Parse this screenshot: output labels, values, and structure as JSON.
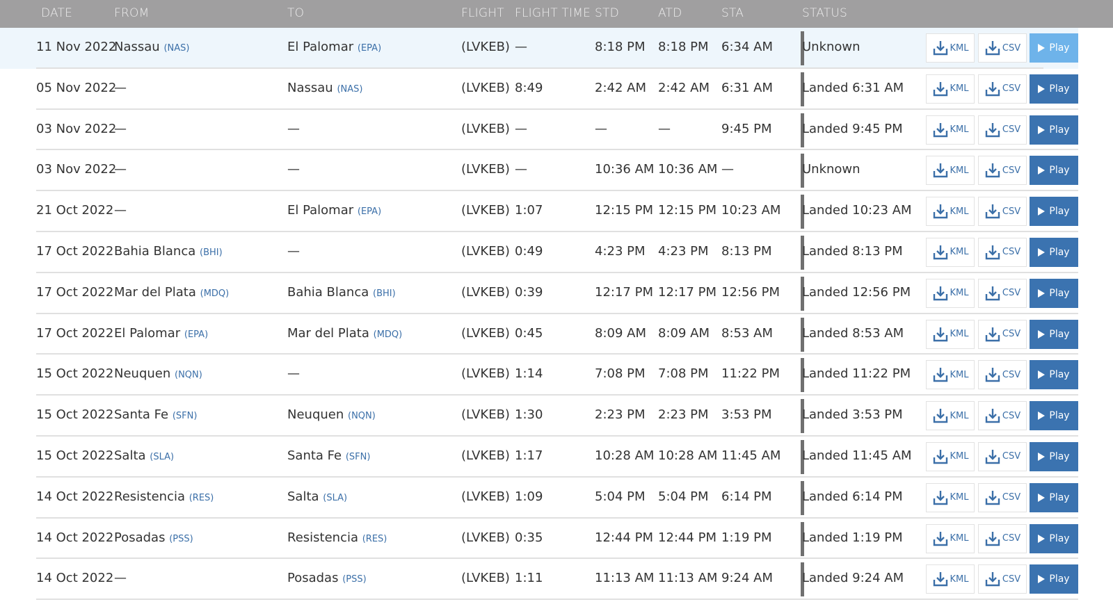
{
  "header": {
    "date": "DATE",
    "from": "FROM",
    "to": "TO",
    "flight": "FLIGHT",
    "flight_time": "FLIGHT TIME",
    "std": "STD",
    "atd": "ATD",
    "sta": "STA",
    "status": "STATUS"
  },
  "buttons": {
    "kml": "KML",
    "csv": "CSV",
    "play": "Play"
  },
  "colors": {
    "header_bg": "#a09fa0",
    "play": "#3b73b0",
    "play_light": "#6eb3ea",
    "code": "#3b6fa8",
    "highlight": "#eef6fc"
  },
  "rows": [
    {
      "date": "11 Nov 2022",
      "from": "Nassau",
      "from_code": "(NAS)",
      "to": "El Palomar",
      "to_code": "(EPA)",
      "flight": "(LVKEB)",
      "flight_time": "—",
      "std": "8:18 PM",
      "atd": "8:18 PM",
      "sta": "6:34 AM",
      "status": "Unknown",
      "highlighted": true
    },
    {
      "date": "05 Nov 2022",
      "from": "—",
      "from_code": "",
      "to": "Nassau",
      "to_code": "(NAS)",
      "flight": "(LVKEB)",
      "flight_time": "8:49",
      "std": "2:42 AM",
      "atd": "2:42 AM",
      "sta": "6:31 AM",
      "status": "Landed 6:31 AM"
    },
    {
      "date": "03 Nov 2022",
      "from": "—",
      "from_code": "",
      "to": "—",
      "to_code": "",
      "flight": "(LVKEB)",
      "flight_time": "—",
      "std": "—",
      "atd": "—",
      "sta": "9:45 PM",
      "status": "Landed 9:45 PM"
    },
    {
      "date": "03 Nov 2022",
      "from": "—",
      "from_code": "",
      "to": "—",
      "to_code": "",
      "flight": "(LVKEB)",
      "flight_time": "—",
      "std": "10:36 AM",
      "atd": "10:36 AM",
      "sta": "—",
      "status": "Unknown"
    },
    {
      "date": "21 Oct 2022",
      "from": "—",
      "from_code": "",
      "to": "El Palomar",
      "to_code": "(EPA)",
      "flight": "(LVKEB)",
      "flight_time": "1:07",
      "std": "12:15 PM",
      "atd": "12:15 PM",
      "sta": "10:23 AM",
      "status": "Landed 10:23 AM"
    },
    {
      "date": "17 Oct 2022",
      "from": "Bahia Blanca",
      "from_code": "(BHI)",
      "to": "—",
      "to_code": "",
      "flight": "(LVKEB)",
      "flight_time": "0:49",
      "std": "4:23 PM",
      "atd": "4:23 PM",
      "sta": "8:13 PM",
      "status": "Landed 8:13 PM"
    },
    {
      "date": "17 Oct 2022",
      "from": "Mar del Plata",
      "from_code": "(MDQ)",
      "to": "Bahia Blanca",
      "to_code": "(BHI)",
      "flight": "(LVKEB)",
      "flight_time": "0:39",
      "std": "12:17 PM",
      "atd": "12:17 PM",
      "sta": "12:56 PM",
      "status": "Landed 12:56 PM"
    },
    {
      "date": "17 Oct 2022",
      "from": "El Palomar",
      "from_code": "(EPA)",
      "to": "Mar del Plata",
      "to_code": "(MDQ)",
      "flight": "(LVKEB)",
      "flight_time": "0:45",
      "std": "8:09 AM",
      "atd": "8:09 AM",
      "sta": "8:53 AM",
      "status": "Landed 8:53 AM"
    },
    {
      "date": "15 Oct 2022",
      "from": "Neuquen",
      "from_code": "(NQN)",
      "to": "—",
      "to_code": "",
      "flight": "(LVKEB)",
      "flight_time": "1:14",
      "std": "7:08 PM",
      "atd": "7:08 PM",
      "sta": "11:22 PM",
      "status": "Landed 11:22 PM"
    },
    {
      "date": "15 Oct 2022",
      "from": "Santa Fe",
      "from_code": "(SFN)",
      "to": "Neuquen",
      "to_code": "(NQN)",
      "flight": "(LVKEB)",
      "flight_time": "1:30",
      "std": "2:23 PM",
      "atd": "2:23 PM",
      "sta": "3:53 PM",
      "status": "Landed 3:53 PM"
    },
    {
      "date": "15 Oct 2022",
      "from": "Salta",
      "from_code": "(SLA)",
      "to": "Santa Fe",
      "to_code": "(SFN)",
      "flight": "(LVKEB)",
      "flight_time": "1:17",
      "std": "10:28 AM",
      "atd": "10:28 AM",
      "sta": "11:45 AM",
      "status": "Landed 11:45 AM"
    },
    {
      "date": "14 Oct 2022",
      "from": "Resistencia",
      "from_code": "(RES)",
      "to": "Salta",
      "to_code": "(SLA)",
      "flight": "(LVKEB)",
      "flight_time": "1:09",
      "std": "5:04 PM",
      "atd": "5:04 PM",
      "sta": "6:14 PM",
      "status": "Landed 6:14 PM"
    },
    {
      "date": "14 Oct 2022",
      "from": "Posadas",
      "from_code": "(PSS)",
      "to": "Resistencia",
      "to_code": "(RES)",
      "flight": "(LVKEB)",
      "flight_time": "0:35",
      "std": "12:44 PM",
      "atd": "12:44 PM",
      "sta": "1:19 PM",
      "status": "Landed 1:19 PM"
    },
    {
      "date": "14 Oct 2022",
      "from": "—",
      "from_code": "",
      "to": "Posadas",
      "to_code": "(PSS)",
      "flight": "(LVKEB)",
      "flight_time": "1:11",
      "std": "11:13 AM",
      "atd": "11:13 AM",
      "sta": "9:24 AM",
      "status": "Landed 9:24 AM"
    }
  ]
}
